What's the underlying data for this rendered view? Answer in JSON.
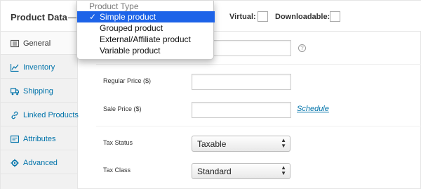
{
  "header": {
    "title": "Product Data",
    "dash": "—",
    "virtual_label": "Virtual:",
    "downloadable_label": "Downloadable:"
  },
  "dropdown": {
    "title": "Product Type",
    "check_glyph": "✓",
    "options": [
      {
        "label": "Simple product",
        "selected": true
      },
      {
        "label": "Grouped product",
        "selected": false
      },
      {
        "label": "External/Affiliate product",
        "selected": false
      },
      {
        "label": "Variable product",
        "selected": false
      }
    ]
  },
  "tabs": [
    {
      "label": "General",
      "icon": "general-icon",
      "active": true
    },
    {
      "label": "Inventory",
      "icon": "inventory-icon",
      "active": false
    },
    {
      "label": "Shipping",
      "icon": "truck-icon",
      "active": false
    },
    {
      "label": "Linked Products",
      "icon": "link-icon",
      "active": false
    },
    {
      "label": "Attributes",
      "icon": "attributes-icon",
      "active": false
    },
    {
      "label": "Advanced",
      "icon": "gear-icon",
      "active": false
    }
  ],
  "fields": {
    "help_glyph": "?",
    "regular_price_label": "Regular Price ($)",
    "regular_price_value": "",
    "sale_price_label": "Sale Price ($)",
    "sale_price_value": "",
    "schedule_link": "Schedule",
    "tax_status_label": "Tax Status",
    "tax_status_value": "Taxable",
    "tax_class_label": "Tax Class",
    "tax_class_value": "Standard",
    "select_arrows": "▲▼"
  },
  "colors": {
    "link": "#0073aa",
    "highlight": "#1d63e8"
  }
}
